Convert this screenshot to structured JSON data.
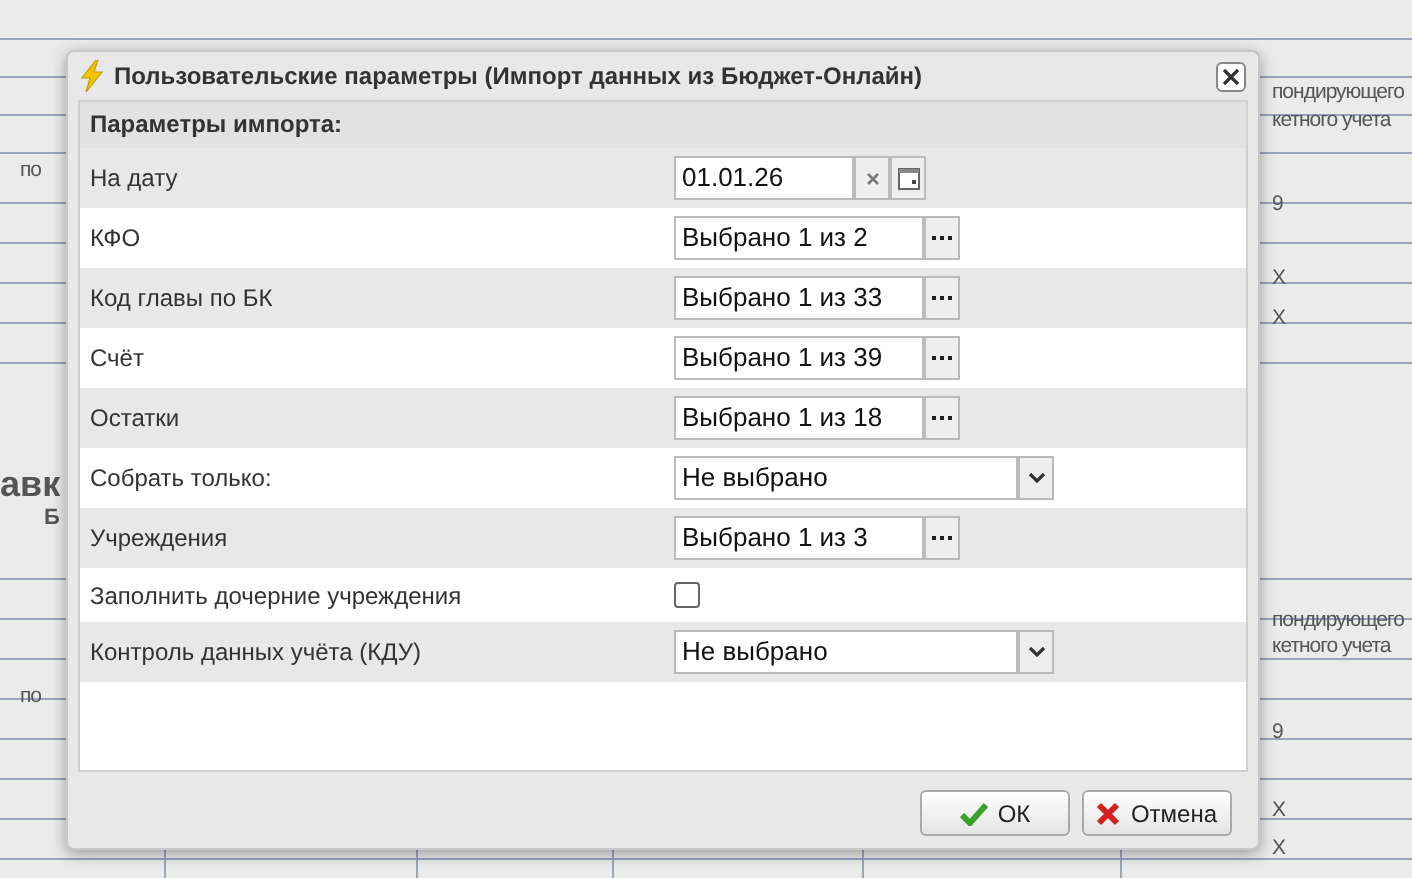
{
  "background": {
    "texts": [
      {
        "text": "пондирующего",
        "kind": "plain"
      },
      {
        "text": "кетного учета",
        "kind": "plain"
      },
      {
        "text": "по",
        "kind": "plain"
      },
      {
        "text": "9",
        "kind": "plain"
      },
      {
        "text": "X",
        "kind": "plain"
      },
      {
        "text": "X",
        "kind": "plain"
      },
      {
        "text": "авк",
        "kind": "heading"
      },
      {
        "text": "Б",
        "kind": "bold"
      },
      {
        "text": "пондирующего",
        "kind": "plain"
      },
      {
        "text": "кетного учета",
        "kind": "plain"
      },
      {
        "text": "по",
        "kind": "plain"
      },
      {
        "text": "9",
        "kind": "plain"
      },
      {
        "text": "X",
        "kind": "plain"
      },
      {
        "text": "X",
        "kind": "plain"
      }
    ]
  },
  "dialog": {
    "title": "Пользовательские параметры (Импорт данных из Бюджет-Онлайн)",
    "section": "Параметры импорта:",
    "rows": [
      {
        "label": "На дату",
        "kind": "date",
        "value": "01.01.26"
      },
      {
        "label": "КФО",
        "kind": "lookup",
        "value": "Выбрано 1 из 2"
      },
      {
        "label": "Код главы по БК",
        "kind": "lookup",
        "value": "Выбрано 1 из 33"
      },
      {
        "label": "Счёт",
        "kind": "lookup",
        "value": "Выбрано 1 из 39"
      },
      {
        "label": "Остатки",
        "kind": "lookup",
        "value": "Выбрано 1 из 18"
      },
      {
        "label": "Собрать только:",
        "kind": "combo",
        "value": "Не выбрано"
      },
      {
        "label": "Учреждения",
        "kind": "lookup",
        "value": "Выбрано 1 из 3"
      },
      {
        "label": "Заполнить дочерние учреждения",
        "kind": "checkbox",
        "checked": false
      },
      {
        "label": "Контроль данных учёта (КДУ)",
        "kind": "combo",
        "value": "Не выбрано"
      }
    ],
    "buttons": [
      {
        "label": "ОК",
        "kind": "ok"
      },
      {
        "label": "Отмена",
        "kind": "cancel"
      }
    ]
  }
}
